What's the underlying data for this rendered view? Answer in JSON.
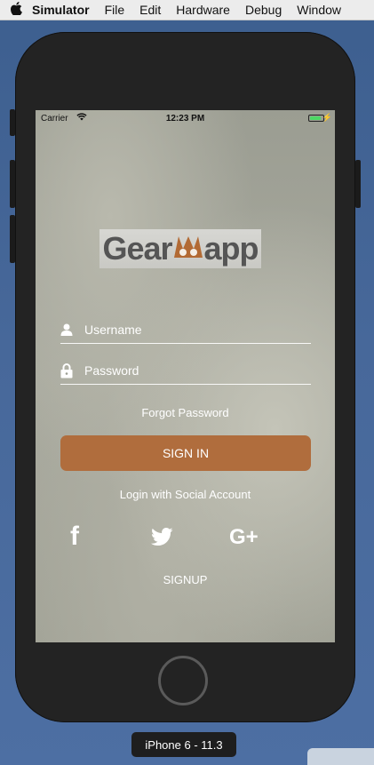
{
  "menubar": {
    "apple": "",
    "items": [
      "Simulator",
      "File",
      "Edit",
      "Hardware",
      "Debug",
      "Window"
    ]
  },
  "status": {
    "carrier": "Carrier",
    "time": "12:23 PM",
    "battery_level": 0.85
  },
  "logo": {
    "text_before": "Gear",
    "text_mark": "",
    "text_after": "app"
  },
  "login": {
    "username_placeholder": "Username",
    "password_placeholder": "Password",
    "forgot": "Forgot Password",
    "signin": "SIGN IN",
    "social_title": "Login with Social Account",
    "signup": "SIGNUP"
  },
  "social": {
    "facebook": "f",
    "google": "G+"
  },
  "device_label": "iPhone 6 - 11.3",
  "colors": {
    "accent": "#b06d3d",
    "battery": "#4cd964"
  }
}
